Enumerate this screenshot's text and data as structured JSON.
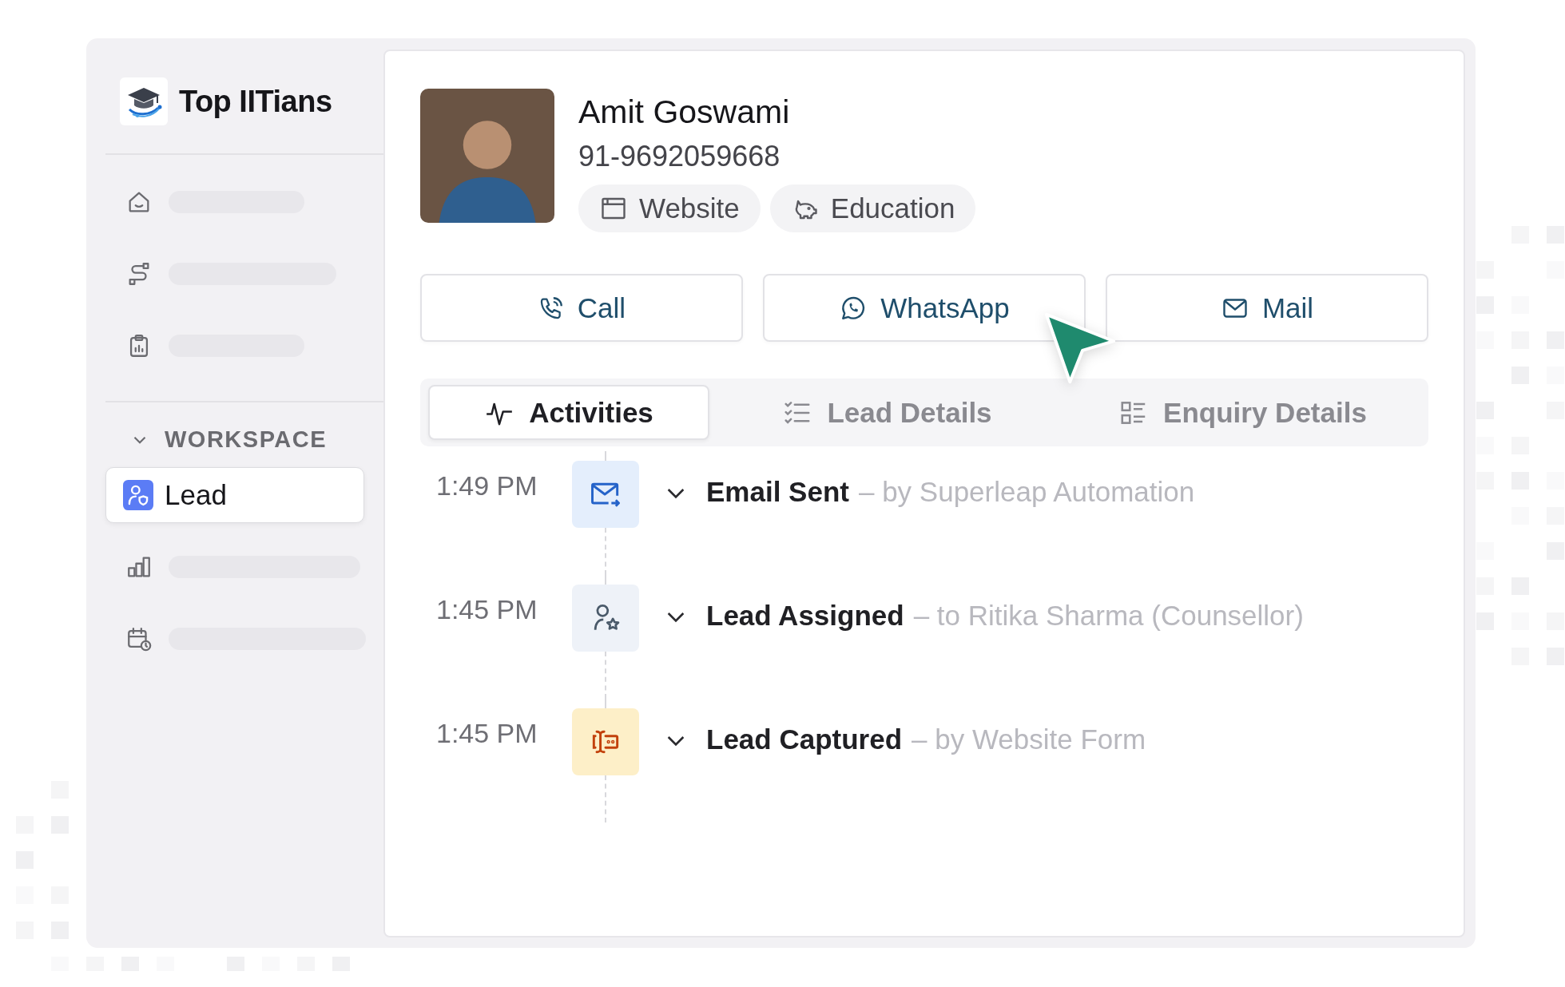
{
  "sidebar": {
    "brand": "Top IITians",
    "items": [
      {
        "kind": "home",
        "selected": false
      },
      {
        "kind": "route",
        "selected": false
      },
      {
        "kind": "clipboard",
        "selected": false
      }
    ],
    "section": {
      "label": "WORKSPACE",
      "expanded": true,
      "items": [
        {
          "kind": "lead",
          "label": "Lead",
          "selected": true
        },
        {
          "kind": "chart",
          "selected": false
        },
        {
          "kind": "calendar",
          "selected": false
        }
      ]
    }
  },
  "lead": {
    "name": "Amit Goswami",
    "phone": "91-9692059668",
    "tags": [
      {
        "kind": "source",
        "label": "Website"
      },
      {
        "kind": "category",
        "label": "Education"
      }
    ]
  },
  "actions": [
    {
      "kind": "call",
      "label": "Call"
    },
    {
      "kind": "whatsapp",
      "label": "WhatsApp"
    },
    {
      "kind": "mail",
      "label": "Mail"
    }
  ],
  "tabs": [
    {
      "kind": "activity",
      "label": "Activities",
      "selected": true
    },
    {
      "kind": "checklist",
      "label": "Lead Details",
      "selected": false
    },
    {
      "kind": "grid",
      "label": "Enquiry Details",
      "selected": false
    }
  ],
  "timeline": [
    {
      "kind": "email",
      "time": "1:49 PM",
      "title": "Email Sent",
      "detail": "– by Superleap Automation"
    },
    {
      "kind": "assigned",
      "time": "1:45 PM",
      "title": "Lead Assigned",
      "detail": "– to Ritika Sharma (Counsellor)"
    },
    {
      "kind": "captured",
      "time": "1:45 PM",
      "title": "Lead Captured",
      "detail": "– by Website Form"
    }
  ]
}
